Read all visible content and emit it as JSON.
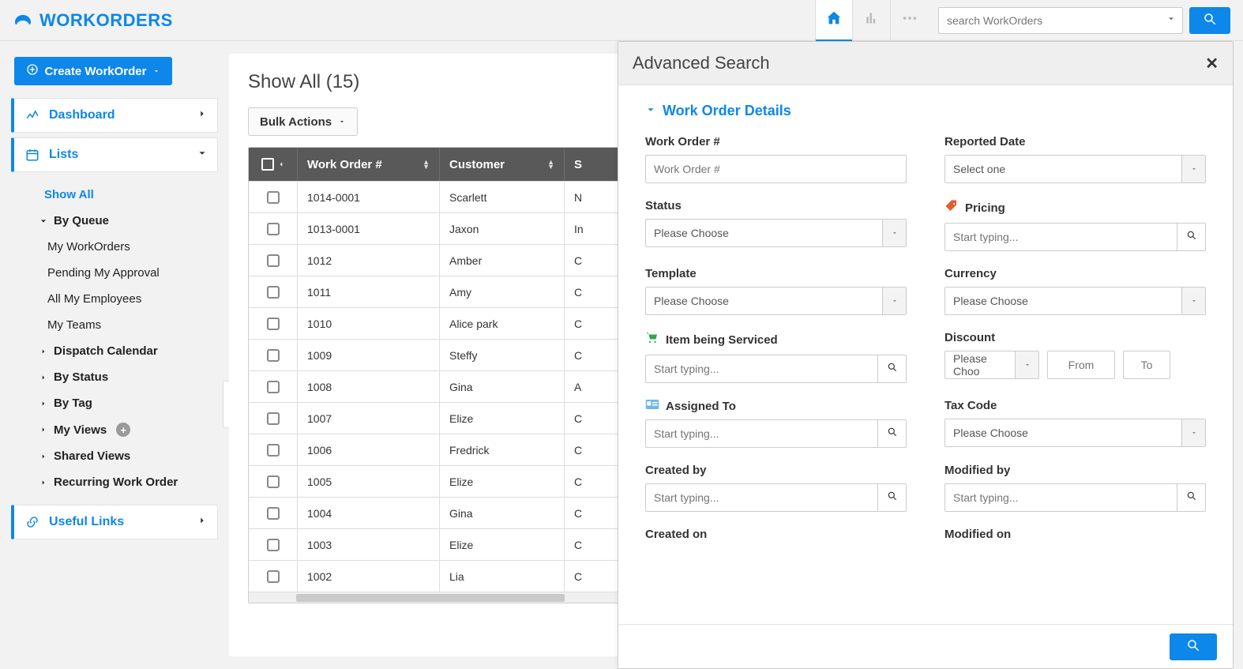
{
  "brand": {
    "name": "WORKORDERS"
  },
  "search": {
    "placeholder": "search WorkOrders"
  },
  "createButton": "Create WorkOrder",
  "nav": {
    "dashboard": "Dashboard",
    "lists": "Lists",
    "usefulLinks": "Useful Links"
  },
  "listsMenu": {
    "showAll": "Show All",
    "byQueue": "By Queue",
    "queueItems": [
      "My WorkOrders",
      "Pending My Approval",
      "All My Employees",
      "My Teams"
    ],
    "dispatchCalendar": "Dispatch Calendar",
    "byStatus": "By Status",
    "byTag": "By Tag",
    "myViews": "My Views",
    "sharedViews": "Shared Views",
    "recurring": "Recurring Work Order"
  },
  "page": {
    "title": "Show All (15)"
  },
  "bulkActions": "Bulk Actions",
  "table": {
    "headers": {
      "wo": "Work Order #",
      "customer": "Customer",
      "third": "S"
    },
    "rows": [
      {
        "wo": "1014-0001",
        "customer": "Scarlett",
        "third": "N"
      },
      {
        "wo": "1013-0001",
        "customer": "Jaxon",
        "third": "In"
      },
      {
        "wo": "1012",
        "customer": "Amber",
        "third": "C"
      },
      {
        "wo": "1011",
        "customer": "Amy",
        "third": "C"
      },
      {
        "wo": "1010",
        "customer": "Alice park",
        "third": "C"
      },
      {
        "wo": "1009",
        "customer": "Steffy",
        "third": "C"
      },
      {
        "wo": "1008",
        "customer": "Gina",
        "third": "A"
      },
      {
        "wo": "1007",
        "customer": "Elize",
        "third": "C"
      },
      {
        "wo": "1006",
        "customer": "Fredrick",
        "third": "C"
      },
      {
        "wo": "1005",
        "customer": "Elize",
        "third": "C"
      },
      {
        "wo": "1004",
        "customer": "Gina",
        "third": "C"
      },
      {
        "wo": "1003",
        "customer": "Elize",
        "third": "C"
      },
      {
        "wo": "1002",
        "customer": "Lia",
        "third": "C"
      }
    ]
  },
  "adv": {
    "title": "Advanced Search",
    "section": "Work Order Details",
    "labels": {
      "wo": "Work Order #",
      "reportedDate": "Reported Date",
      "status": "Status",
      "pricing": "Pricing",
      "template": "Template",
      "currency": "Currency",
      "item": "Item being Serviced",
      "discount": "Discount",
      "assigned": "Assigned To",
      "taxCode": "Tax Code",
      "createdBy": "Created by",
      "modifiedBy": "Modified by",
      "createdOn": "Created on",
      "modifiedOn": "Modified on"
    },
    "placeholders": {
      "wo": "Work Order #",
      "startTyping": "Start typing...",
      "from": "From",
      "to": "To"
    },
    "defaults": {
      "pleaseChoose": "Please Choose",
      "selectOne": "Select one",
      "pleaseChoShort": "Please Choo"
    }
  }
}
